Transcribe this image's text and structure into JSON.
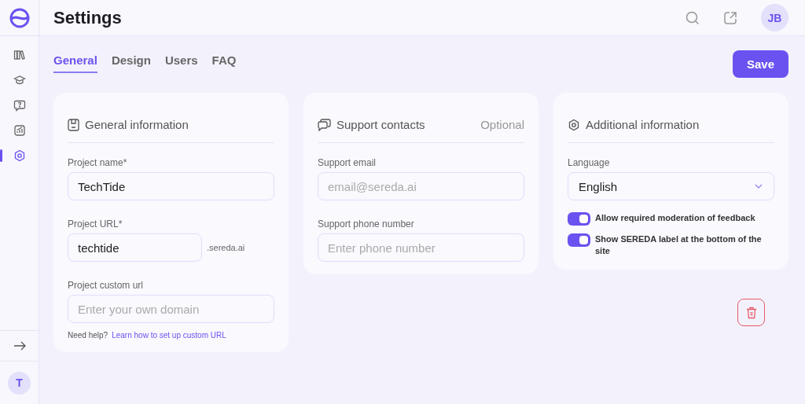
{
  "header": {
    "title": "Settings",
    "avatar": "JB"
  },
  "sidebar": {
    "items": [
      {
        "selected": false
      },
      {
        "selected": false
      },
      {
        "selected": false
      },
      {
        "selected": false
      },
      {
        "selected": true
      }
    ],
    "user_avatar": "T"
  },
  "tabs": [
    {
      "label": "General",
      "selected": true
    },
    {
      "label": "Design",
      "selected": false
    },
    {
      "label": "Users",
      "selected": false
    },
    {
      "label": "FAQ",
      "selected": false
    }
  ],
  "save_button": "Save",
  "general_information": {
    "title": "General information",
    "project_name": {
      "label": "Project name*",
      "value": "TechTide"
    },
    "project_url": {
      "label": "Project URL*",
      "value": "techtide",
      "suffix": ".sereda.ai"
    },
    "custom_url": {
      "label": "Project custom url",
      "placeholder": "Enter your own domain"
    },
    "help_text": "Need help?",
    "help_link": "Learn how to set up custom URL"
  },
  "support_contacts": {
    "title": "Support contacts",
    "badge": "Optional",
    "email": {
      "label": "Support email",
      "placeholder": "email@sereda.ai"
    },
    "phone": {
      "label": "Support phone number",
      "placeholder": "Enter phone number"
    }
  },
  "additional_information": {
    "title": "Additional information",
    "language": {
      "label": "Language",
      "value": "English"
    },
    "toggles": [
      {
        "label": "Allow required moderation of feedback",
        "on": true
      },
      {
        "label": "Show SEREDA label at the bottom of the site",
        "on": true
      }
    ]
  }
}
